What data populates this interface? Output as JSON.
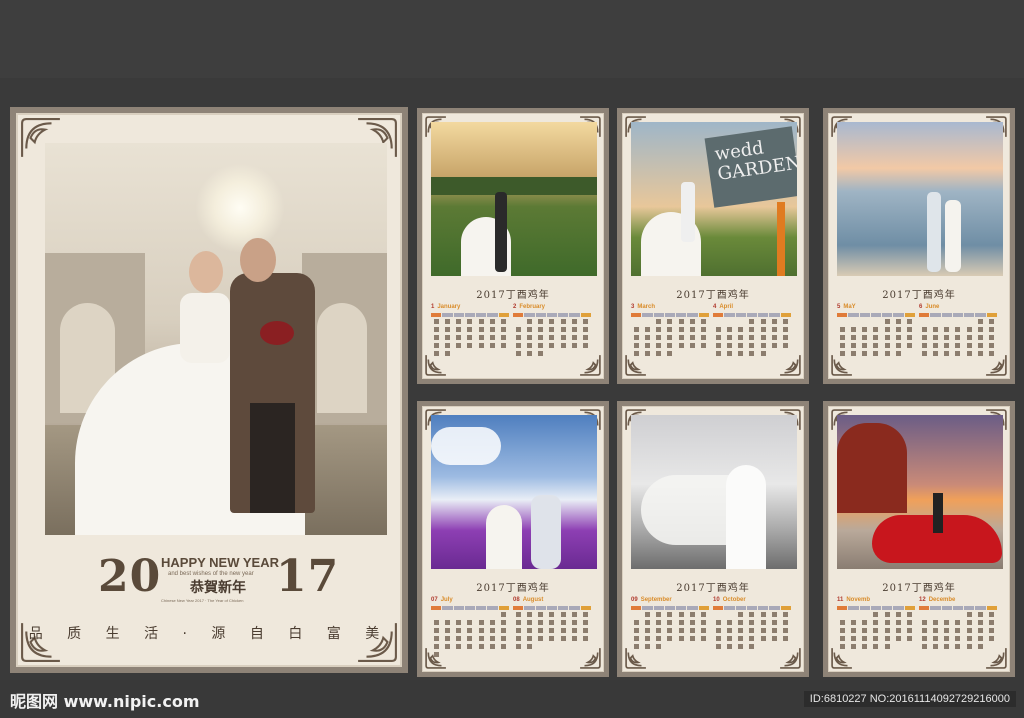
{
  "cover": {
    "year_left": "20",
    "year_right": "17",
    "greeting_en": "HAPPY NEW YEAR",
    "greeting_sub": "and best wishes of the new year",
    "greeting_cn": "恭賀新年",
    "small_caption": "Chinese New Year 2017  ·  The Year of Chicken",
    "tagline": "品 质 生 活 · 源 自 白 富 美"
  },
  "pages": [
    {
      "title": "2017丁酉鸡年",
      "months": [
        {
          "num": "1",
          "name": "January"
        },
        {
          "num": "2",
          "name": "February"
        }
      ]
    },
    {
      "title": "2017丁酉鸡年",
      "months": [
        {
          "num": "3",
          "name": "March"
        },
        {
          "num": "4",
          "name": "April"
        }
      ]
    },
    {
      "title": "2017丁酉鸡年",
      "months": [
        {
          "num": "5",
          "name": "MaY"
        },
        {
          "num": "6",
          "name": "June"
        }
      ]
    },
    {
      "title": "2017丁酉鸡年",
      "months": [
        {
          "num": "07",
          "name": "July"
        },
        {
          "num": "08",
          "name": "August"
        }
      ]
    },
    {
      "title": "2017丁酉鸡年",
      "months": [
        {
          "num": "09",
          "name": "September"
        },
        {
          "num": "10",
          "name": "October"
        }
      ]
    },
    {
      "title": "2017丁酉鸡年",
      "months": [
        {
          "num": "11",
          "name": "Novemb"
        },
        {
          "num": "12",
          "name": "Decembe"
        }
      ]
    }
  ],
  "sign_text": "wedd\nGARDEN 20",
  "watermark": {
    "left": "昵图网 www.nipic.com",
    "right": "ID:6810227 NO:20161114092729216000"
  },
  "colors": {
    "frame": "#8e8377",
    "paper": "#efe8dc",
    "ink": "#4a3c30",
    "background": "#3a3a3a"
  }
}
